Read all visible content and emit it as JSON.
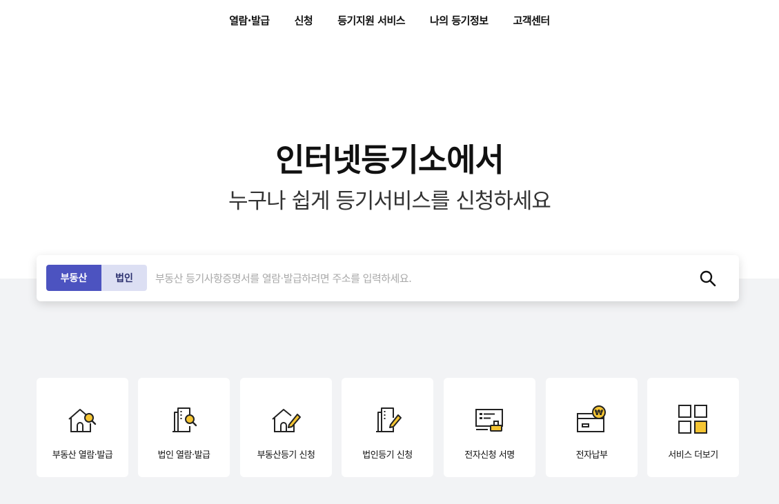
{
  "nav": {
    "items": [
      "열람·발급",
      "신청",
      "등기지원 서비스",
      "나의 등기정보",
      "고객센터"
    ]
  },
  "hero": {
    "title": "인터넷등기소에서",
    "subtitle": "누구나 쉽게 등기서비스를 신청하세요"
  },
  "search": {
    "tabs": [
      "부동산",
      "법인"
    ],
    "active_tab": "부동산",
    "placeholder": "부동산 등기사항증명서를 열람·발급하려면 주소를 입력하세요.",
    "button_icon": "search-icon"
  },
  "services": [
    {
      "label": "부동산 열람·발급",
      "icon": "house-search-icon"
    },
    {
      "label": "법인 열람·발급",
      "icon": "building-search-icon"
    },
    {
      "label": "부동산등기 신청",
      "icon": "house-pen-icon"
    },
    {
      "label": "법인등기 신청",
      "icon": "building-pen-icon"
    },
    {
      "label": "전자신청 서명",
      "icon": "document-stamp-icon"
    },
    {
      "label": "전자납부",
      "icon": "card-won-icon"
    },
    {
      "label": "서비스 더보기",
      "icon": "grid-more-icon"
    }
  ],
  "colors": {
    "accent": "#4c53c0",
    "accent_light": "#dcdff3",
    "icon_highlight": "#f5c533",
    "background_gray": "#f2f3f5"
  }
}
